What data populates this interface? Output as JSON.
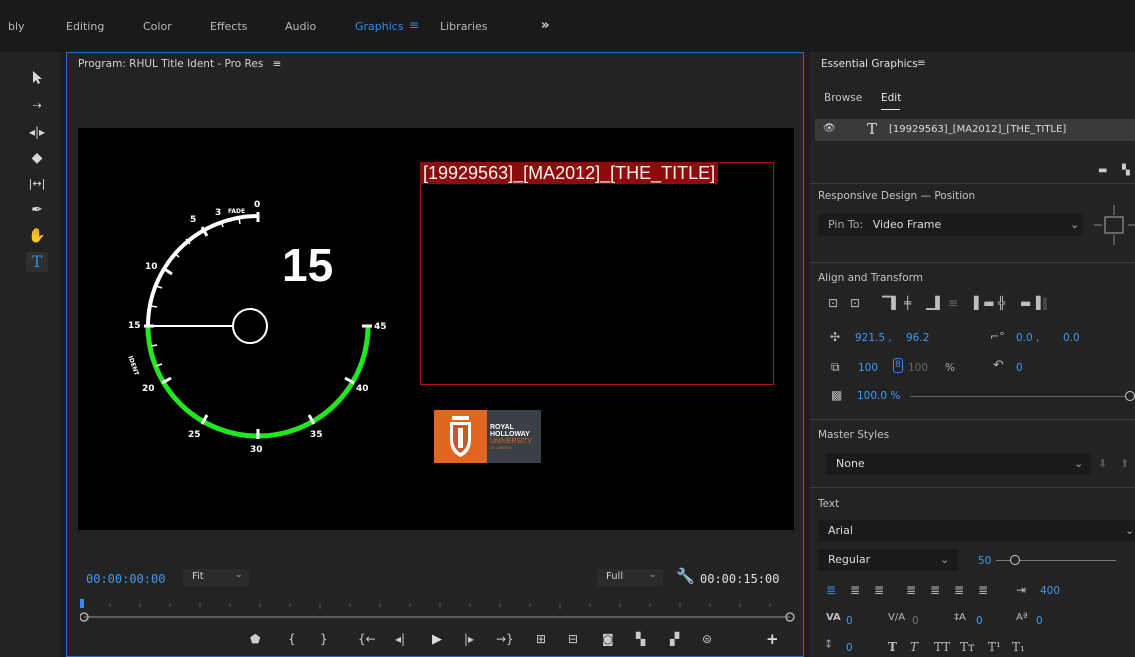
{
  "workspaces": [
    {
      "label": "bly",
      "active": false
    },
    {
      "label": "Editing",
      "active": false
    },
    {
      "label": "Color",
      "active": false
    },
    {
      "label": "Effects",
      "active": false
    },
    {
      "label": "Audio",
      "active": false
    },
    {
      "label": "Graphics",
      "active": true
    },
    {
      "label": "Libraries",
      "active": false
    }
  ],
  "workspace_more": "»",
  "monitor": {
    "title": "Program: RHUL Title Ident - Pro Res",
    "title_text": "[19929563]_[MA2012]_[THE_TITLE]",
    "gauge": {
      "countdown": "15",
      "fade_label": "FADE",
      "ident_label": "IDENT",
      "ticks_white": [
        "0",
        "3",
        "5",
        "10",
        "15"
      ],
      "ticks_green": [
        "20",
        "25",
        "30",
        "35",
        "40",
        "45"
      ]
    },
    "logo": {
      "line1": "ROYAL",
      "line2": "HOLLOWAY",
      "line3": "UNIVERSITY",
      "line4": "OF LONDON"
    },
    "timecode_in": "00:00:00:00",
    "fit": "Fit",
    "quality": "Full",
    "timecode_out": "00:00:15:00"
  },
  "essential_graphics": {
    "title": "Essential Graphics",
    "tabs": [
      "Browse",
      "Edit"
    ],
    "active_tab": "Edit",
    "layer": "[19929563]_[MA2012]_[THE_TITLE]",
    "responsive_header": "Responsive Design — Position",
    "pin_to_label": "Pin To:",
    "pin_to_value": "Video Frame",
    "align_header": "Align and Transform",
    "pos_x": "921.5 ,",
    "pos_y": "96.2",
    "anchor_x": "0.0 ,",
    "anchor_y": "0.0",
    "scale": "100",
    "scale_linked": "100",
    "percent": "%",
    "rotation": "0",
    "opacity": "100.0 %",
    "master_styles_header": "Master Styles",
    "master_style": "None",
    "text_header": "Text",
    "font": "Arial",
    "font_style": "Regular",
    "font_size": "50",
    "tracking": "400",
    "kerning": "0",
    "tracking2": "0",
    "leading": "0",
    "baseline": "0",
    "tsume": "0"
  },
  "colors": {
    "accent": "#2d8ceb",
    "gauge_green": "#22e61f",
    "title_red": "#b01212",
    "logo_orange": "#e2661d",
    "logo_gray": "#3a4046"
  }
}
